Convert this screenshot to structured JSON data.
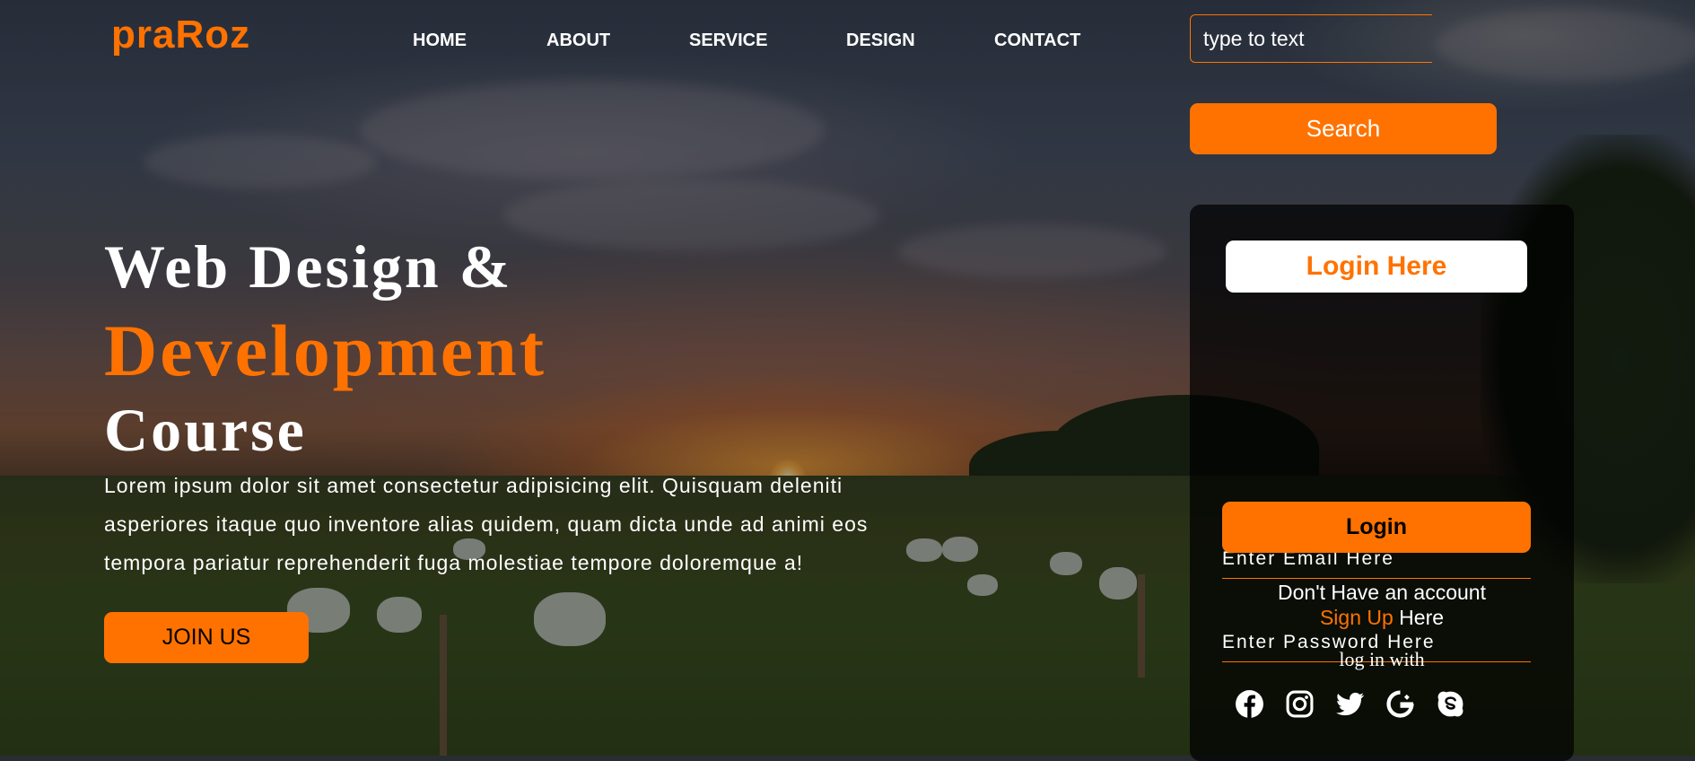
{
  "brand": {
    "logo": "praRoz",
    "accent_color": "#ff7200"
  },
  "nav": {
    "items": [
      {
        "label": "HOME"
      },
      {
        "label": "ABOUT"
      },
      {
        "label": "SERVICE"
      },
      {
        "label": "DESIGN"
      },
      {
        "label": "CONTACT"
      }
    ]
  },
  "search": {
    "placeholder": "type to text",
    "value": "",
    "button_label": "Search"
  },
  "hero": {
    "line1": "Web Design &",
    "line2": "Development",
    "line3": "Course",
    "description": "Lorem ipsum dolor sit amet consectetur adipisicing elit. Quisquam deleniti asperiores itaque quo inventore alias quidem, quam dicta unde ad animi eos tempora pariatur reprehenderit fuga molestiae tempore doloremque a!",
    "cta_label": "JOIN US"
  },
  "login": {
    "title": "Login Here",
    "email_placeholder": "Enter Email Here",
    "password_placeholder": "Enter Password Here",
    "button_label": "Login",
    "no_account_text": "Don't Have an account",
    "signup_link": "Sign Up",
    "signup_suffix": " Here",
    "log_in_with": "log in with",
    "social_icons": [
      "facebook-icon",
      "instagram-icon",
      "twitter-icon",
      "google-icon",
      "skype-icon"
    ]
  }
}
